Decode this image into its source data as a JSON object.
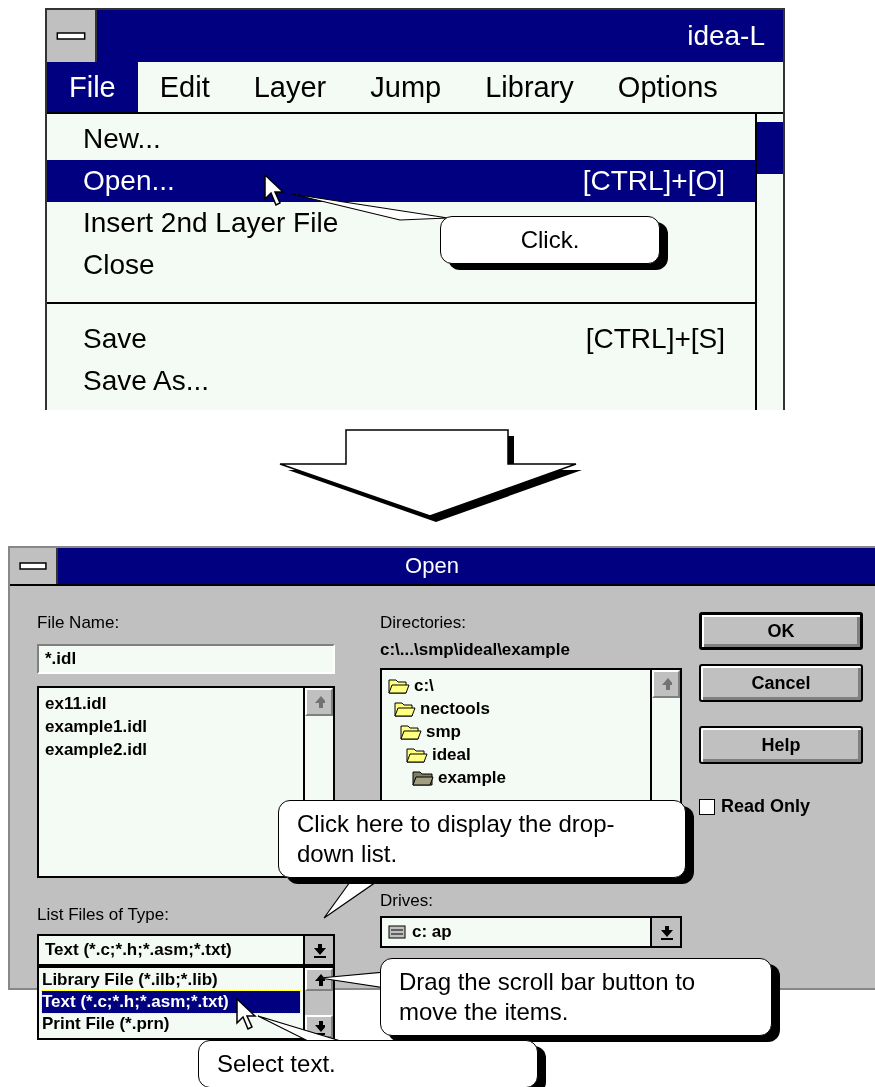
{
  "menu_window": {
    "title": "idea-L",
    "menubar": [
      {
        "label": "File",
        "selected": true
      },
      {
        "label": "Edit",
        "selected": false
      },
      {
        "label": "Layer",
        "selected": false
      },
      {
        "label": "Jump",
        "selected": false
      },
      {
        "label": "Library",
        "selected": false
      },
      {
        "label": "Options",
        "selected": false
      }
    ],
    "file_menu": [
      {
        "kind": "item",
        "label": "New...",
        "selected": false
      },
      {
        "kind": "item",
        "label": "Open...",
        "shortcut": "[CTRL]+[O]",
        "selected": true
      },
      {
        "kind": "item",
        "label": "Insert 2nd Layer File",
        "selected": false
      },
      {
        "kind": "item",
        "label": "Close",
        "selected": false
      },
      {
        "kind": "separator"
      },
      {
        "kind": "item",
        "label": "Save",
        "shortcut": "[CTRL]+[S]",
        "selected": false
      },
      {
        "kind": "item",
        "label": "Save As...",
        "selected": false
      }
    ]
  },
  "open_dialog": {
    "title": "Open",
    "file_name": {
      "label": "File Name:",
      "value": "*.idl"
    },
    "files": [
      {
        "label": "ex11.idl",
        "selected": false
      },
      {
        "label": "example1.idl",
        "selected": false
      },
      {
        "label": "example2.idl",
        "selected": false
      }
    ],
    "directories": {
      "label": "Directories:",
      "path": "c:\\...\\smp\\ideal\\example",
      "tree": [
        {
          "label": "c:\\",
          "selected": false,
          "children": [
            {
              "label": "nectools",
              "selected": false,
              "children": [
                {
                  "label": "smp",
                  "selected": false,
                  "children": [
                    {
                      "label": "ideal",
                      "selected": false,
                      "children": [
                        {
                          "label": "example",
                          "selected": true
                        }
                      ]
                    }
                  ]
                }
              ]
            }
          ]
        }
      ]
    },
    "buttons": [
      {
        "label": "OK",
        "default": true
      },
      {
        "label": "Cancel",
        "default": false
      },
      {
        "label": "Help",
        "default": false
      }
    ],
    "read_only": {
      "label": "Read Only",
      "checked": false
    },
    "file_type": {
      "label": "List Files of Type:",
      "value": "Text (*.c;*.h;*.asm;*.txt)",
      "options": [
        {
          "label": "Library File (*.ilb;*.lib)",
          "selected": false
        },
        {
          "label": "Text (*.c;*.h;*.asm;*.txt)",
          "selected": true
        },
        {
          "label": "Print File (*.prn)",
          "selected": false
        }
      ]
    },
    "drives": {
      "label": "Drives:",
      "value": "c: ap"
    }
  },
  "callouts": [
    {
      "text": "Click."
    },
    {
      "text": "Click here to display the drop-down list."
    },
    {
      "text": "Drag the scroll bar button to move the items."
    },
    {
      "text": "Select text."
    }
  ]
}
